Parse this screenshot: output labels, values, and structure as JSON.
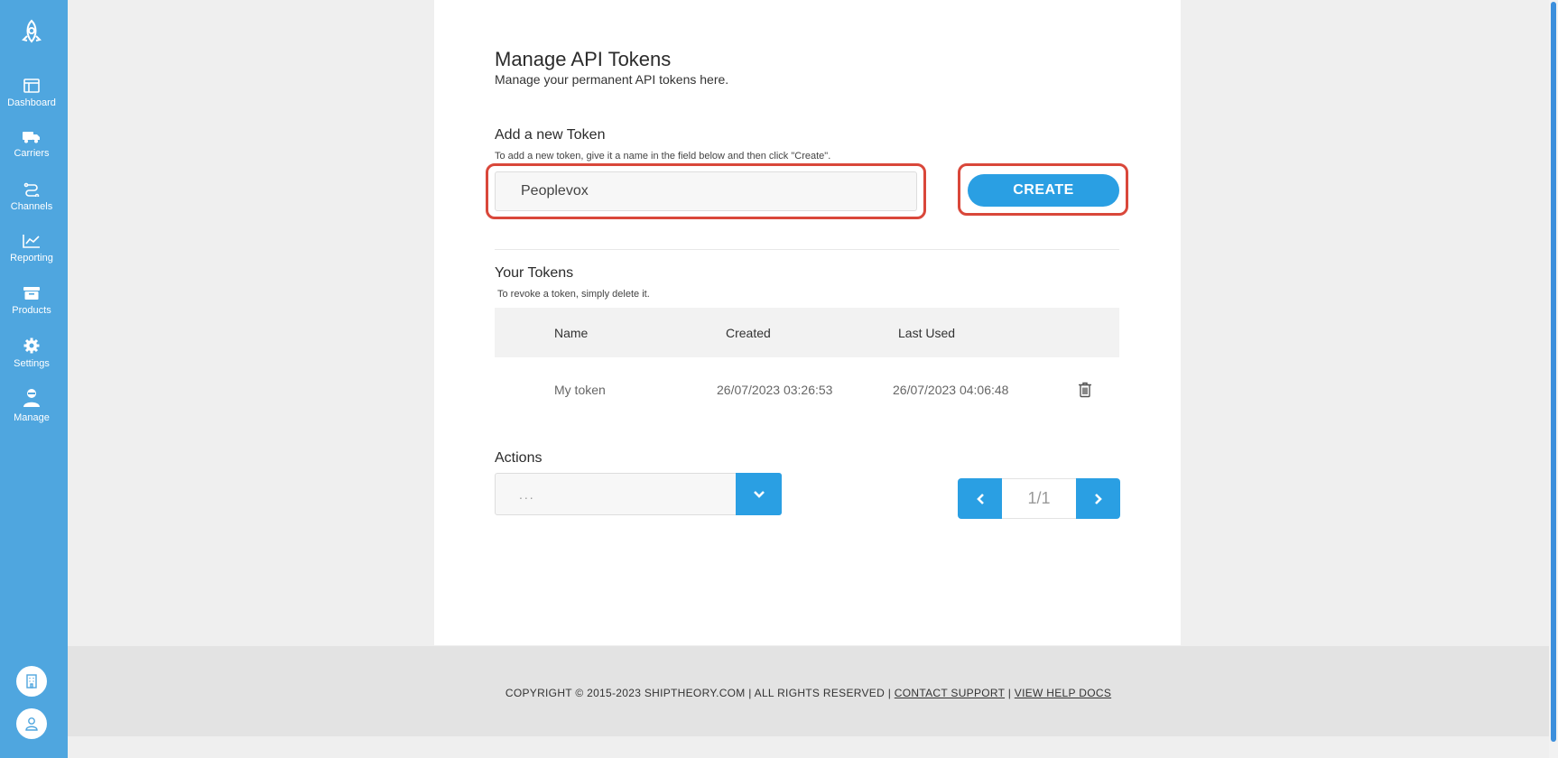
{
  "sidebar": {
    "items": [
      {
        "label": "Dashboard",
        "icon": "dashboard-icon"
      },
      {
        "label": "Carriers",
        "icon": "truck-icon"
      },
      {
        "label": "Channels",
        "icon": "channels-icon"
      },
      {
        "label": "Reporting",
        "icon": "chart-icon"
      },
      {
        "label": "Products",
        "icon": "box-icon"
      },
      {
        "label": "Settings",
        "icon": "gear-icon"
      },
      {
        "label": "Manage",
        "icon": "user-manage-icon"
      }
    ],
    "bottom": [
      {
        "icon": "building-icon"
      },
      {
        "icon": "user-icon"
      }
    ]
  },
  "page": {
    "title": "Manage API Tokens",
    "subtitle": "Manage your permanent API tokens here."
  },
  "new_token": {
    "heading": "Add a new Token",
    "hint": "To add a new token, give it a name in the field below and then click \"Create\".",
    "input_value": "Peoplevox",
    "create_label": "CREATE"
  },
  "tokens": {
    "heading": "Your Tokens",
    "hint": "To revoke a token, simply delete it.",
    "columns": [
      "Name",
      "Created",
      "Last Used"
    ],
    "rows": [
      {
        "name": "My token",
        "created": "26/07/2023 03:26:53",
        "last_used": "26/07/2023 04:06:48"
      }
    ]
  },
  "actions": {
    "heading": "Actions",
    "selected": "..."
  },
  "pagination": {
    "page": "1/1"
  },
  "footer": {
    "copyright": "COPYRIGHT © 2015-2023 SHIPTHEORY.COM",
    "rights": "ALL RIGHTS RESERVED",
    "contact": "CONTACT SUPPORT",
    "docs": "VIEW HELP DOCS",
    "separator": "|"
  },
  "colors": {
    "sidebar": "#4fa6df",
    "accent": "#2a9fe3",
    "highlight": "#d9473a"
  }
}
